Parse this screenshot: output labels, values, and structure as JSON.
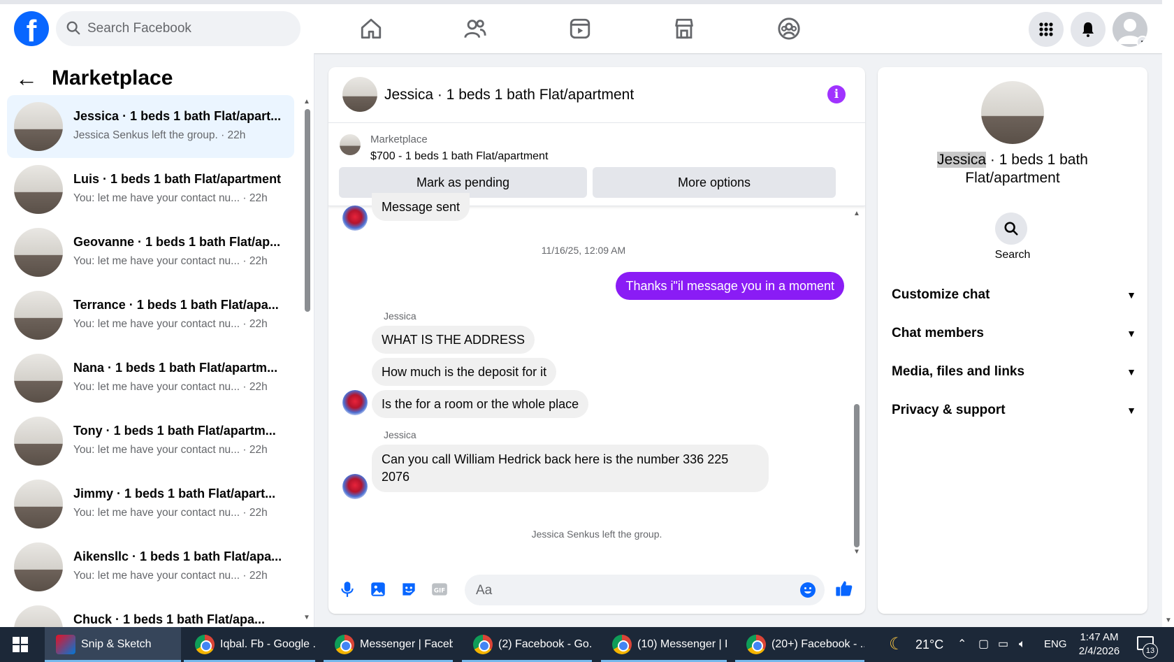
{
  "topbar": {
    "search_placeholder": "Search Facebook",
    "nav_icons": [
      "home-icon",
      "friends-icon",
      "video-icon",
      "marketplace-icon",
      "groups-icon"
    ],
    "right_icons": [
      "menu-grid-icon",
      "bell-icon",
      "profile-icon"
    ]
  },
  "left": {
    "title": "Marketplace",
    "conversations": [
      {
        "name": "Jessica · 1 beds 1 bath Flat/apart...",
        "sub": "Jessica Senkus left the group. · 22h",
        "active": true
      },
      {
        "name": "Luis · 1 beds 1 bath Flat/apartment",
        "sub": "You: let me have your contact nu...  · 22h"
      },
      {
        "name": "Geovanne · 1 beds 1 bath Flat/ap...",
        "sub": "You: let me have your contact nu...  · 22h"
      },
      {
        "name": "Terrance · 1 beds 1 bath Flat/apa...",
        "sub": "You: let me have your contact nu...  · 22h"
      },
      {
        "name": "Nana · 1 beds 1 bath Flat/apartm...",
        "sub": "You: let me have your contact nu...  · 22h"
      },
      {
        "name": "Tony · 1 beds 1 bath Flat/apartm...",
        "sub": "You: let me have your contact nu...  · 22h"
      },
      {
        "name": "Jimmy · 1 beds 1 bath Flat/apart...",
        "sub": "You: let me have your contact nu...  · 22h"
      },
      {
        "name": "Aikensllc · 1 beds 1 bath Flat/apa...",
        "sub": "You: let me have your contact nu...  · 22h"
      },
      {
        "name": "Chuck · 1 beds 1 bath Flat/apa...",
        "sub": ""
      }
    ]
  },
  "chat": {
    "title": "Jessica · 1 beds 1 bath Flat/apartment",
    "marketplace_label": "Marketplace",
    "listing": "$700 - 1 beds 1 bath Flat/apartment",
    "mark_pending": "Mark as pending",
    "more_options": "More options",
    "messages": {
      "partial_top": "Message sent",
      "timestamp": "11/16/25, 12:09 AM",
      "me_1": "Thanks i\"il message you in a moment",
      "sender_1": "Jessica",
      "them_1": "WHAT IS THE ADDRESS",
      "them_2": "How much is the deposit for it",
      "them_3": "Is the for a room or the whole place",
      "sender_2": "Jessica",
      "them_4a": "Can you call William  Hedrick  back  here is the number 336 225",
      "them_4b": "2076",
      "system": "Jessica Senkus left the group."
    },
    "composer_placeholder": "Aa"
  },
  "right": {
    "title_highlight": "Jessica",
    "title_rest": " · 1 beds 1 bath",
    "title_line2": "Flat/apartment",
    "search_label": "Search",
    "sections": [
      "Customize chat",
      "Chat members",
      "Media, files and links",
      "Privacy & support"
    ]
  },
  "taskbar": {
    "items": [
      "Snip & Sketch",
      "Iqbal. Fb - Google ...",
      "Messenger | Faceb...",
      "(2) Facebook - Go...",
      "(10) Messenger | F...",
      "(20+) Facebook - ..."
    ],
    "temperature": "21°C",
    "lang": "ENG",
    "time": "1:47 AM",
    "date": "2/4/2026",
    "notif_count": "13"
  },
  "colors": {
    "brand": "#0866ff",
    "my_bubble": "#8a1cf5",
    "info": "#a033ff"
  }
}
